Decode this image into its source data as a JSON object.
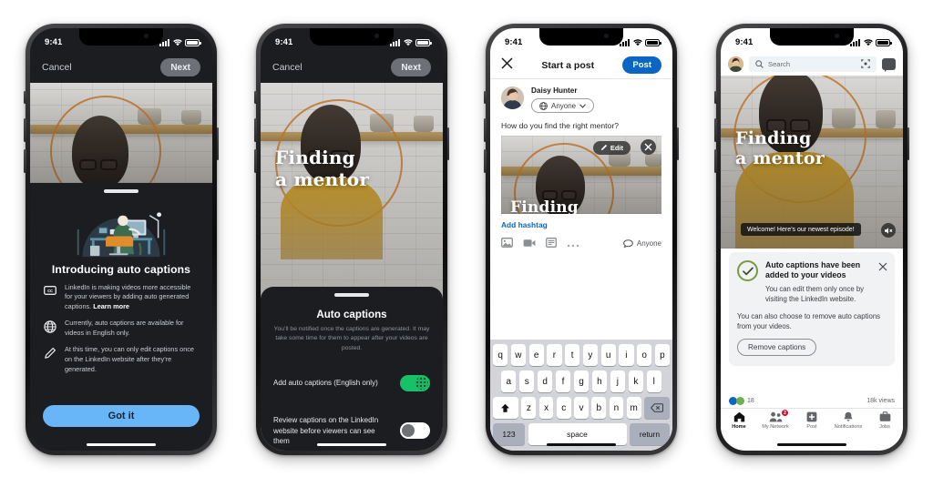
{
  "statusbar": {
    "time": "9:41"
  },
  "phone1": {
    "topbar": {
      "cancel": "Cancel",
      "next": "Next"
    },
    "illustration_alt": "person-at-desk-illustration",
    "heading": "Introducing auto captions",
    "rows": [
      {
        "icon": "cc-icon",
        "text": "LinkedIn is making videos more accessible for your viewers by adding auto generated captions. ",
        "link": "Learn more"
      },
      {
        "icon": "globe-icon",
        "text": "Currently, auto captions are available for videos in English only.",
        "link": ""
      },
      {
        "icon": "pencil-icon",
        "text": "At this time, you can only edit captions once on the LinkedIn website after they’re generated.",
        "link": ""
      }
    ],
    "cta": "Got it"
  },
  "phone2": {
    "topbar": {
      "cancel": "Cancel",
      "next": "Next"
    },
    "video_title_line1": "Finding",
    "video_title_line2": "a mentor",
    "sheet": {
      "heading": "Auto captions",
      "subtitle": "You’ll be notified once the captions are generated. It may take some time for them to appear after your videos are posted.",
      "options": [
        {
          "label": "Add auto captions (English only)",
          "state": "on"
        },
        {
          "label": "Review captions on the LinkedIn website before viewers can see them",
          "state": "off"
        }
      ]
    }
  },
  "phone3": {
    "nav": {
      "close": "close-icon",
      "title": "Start a post",
      "post": "Post"
    },
    "author": {
      "name": "Daisy Hunter",
      "audience": "Anyone"
    },
    "prompt": "How do you find the right mentor?",
    "media": {
      "edit": "Edit",
      "remove": "close-icon",
      "title_line1": "Finding"
    },
    "hashtag": "Add hashtag",
    "tools": {
      "icons": [
        "photo-icon",
        "video-icon",
        "document-icon",
        "more-icon"
      ],
      "audience": "Anyone"
    },
    "keyboard": {
      "row1": [
        "q",
        "w",
        "e",
        "r",
        "t",
        "y",
        "u",
        "i",
        "o",
        "p"
      ],
      "row2": [
        "a",
        "s",
        "d",
        "f",
        "g",
        "h",
        "j",
        "k",
        "l"
      ],
      "row3": [
        "z",
        "x",
        "c",
        "v",
        "b",
        "n",
        "m"
      ],
      "shift": "shift-icon",
      "backspace": "backspace-icon",
      "numbers": "123",
      "space": "space",
      "return": "return",
      "emoji": "emoji-icon",
      "mic": "microphone-icon"
    }
  },
  "phone4": {
    "top": {
      "search_placeholder": "Search",
      "avatar": "profile-avatar",
      "messaging": "messaging-icon"
    },
    "video": {
      "title_line1": "Finding",
      "title_line2": "a mentor",
      "caption": "Welcome! Here’s our newest episode!",
      "mute": "mute-icon"
    },
    "card": {
      "heading": "Auto captions have been added to your videos",
      "paragraph1": "You can edit them only once by visiting the LinkedIn website.",
      "paragraph2": "You can also choose to remove auto captions from your videos.",
      "button": "Remove captions",
      "dismiss": "close-icon"
    },
    "engagement": {
      "reactions": "18",
      "views": "18k views"
    },
    "tabs": [
      {
        "label": "Home",
        "icon": "home-icon",
        "active": true,
        "badge": ""
      },
      {
        "label": "My Network",
        "icon": "network-icon",
        "active": false,
        "badge": "2"
      },
      {
        "label": "Post",
        "icon": "plus-icon",
        "active": false,
        "badge": ""
      },
      {
        "label": "Notifications",
        "icon": "bell-icon",
        "active": false,
        "badge": ""
      },
      {
        "label": "Jobs",
        "icon": "briefcase-icon",
        "active": false,
        "badge": ""
      }
    ]
  },
  "colors": {
    "linkedin_blue": "#0a66c2",
    "cta_blue": "#68b5f7",
    "toggle_green": "#16c167",
    "badge_red": "#cb112d",
    "dark_surface": "#1b1d21"
  }
}
